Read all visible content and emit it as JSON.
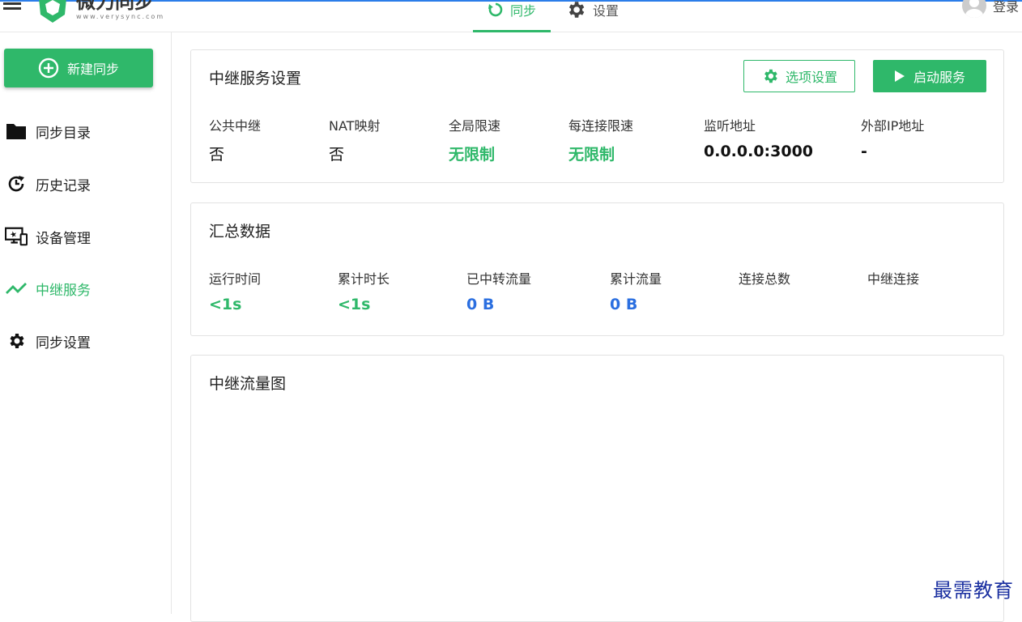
{
  "header": {
    "app_name": "微力同步",
    "app_url": "www.verysync.com",
    "nav": [
      {
        "label": "同步",
        "icon": "sync-icon",
        "active": true
      },
      {
        "label": "设置",
        "icon": "gear-icon",
        "active": false
      }
    ],
    "login_label": "登录"
  },
  "sidebar": {
    "new_sync_label": "新建同步",
    "items": [
      {
        "label": "同步目录",
        "icon": "folder-icon"
      },
      {
        "label": "历史记录",
        "icon": "history-icon"
      },
      {
        "label": "设备管理",
        "icon": "devices-icon"
      },
      {
        "label": "中继服务",
        "icon": "trend-icon",
        "active": true
      },
      {
        "label": "同步设置",
        "icon": "gear-icon"
      }
    ]
  },
  "relay_settings": {
    "title": "中继服务设置",
    "options_button": "选项设置",
    "start_button": "启动服务",
    "stats": [
      {
        "label": "公共中继",
        "value": "否"
      },
      {
        "label": "NAT映射",
        "value": "否"
      },
      {
        "label": "全局限速",
        "value": "无限制"
      },
      {
        "label": "每连接限速",
        "value": "无限制"
      },
      {
        "label": "监听地址",
        "value": "0.0.0.0:3000"
      },
      {
        "label": "外部IP地址",
        "value": "-"
      }
    ]
  },
  "summary": {
    "title": "汇总数据",
    "stats": [
      {
        "label": "运行时间",
        "value": "<1s"
      },
      {
        "label": "累计时长",
        "value": "<1s"
      },
      {
        "label": "已中转流量",
        "value": "0 B"
      },
      {
        "label": "累计流量",
        "value": "0 B"
      },
      {
        "label": "连接总数",
        "value": ""
      },
      {
        "label": "中继连接",
        "value": ""
      }
    ]
  },
  "traffic_chart": {
    "title": "中继流量图"
  },
  "watermark": "最需教育",
  "colors": {
    "accent_green": "#2fb86a",
    "value_blue": "#2b6fe0",
    "top_accent": "#2b7de9"
  }
}
